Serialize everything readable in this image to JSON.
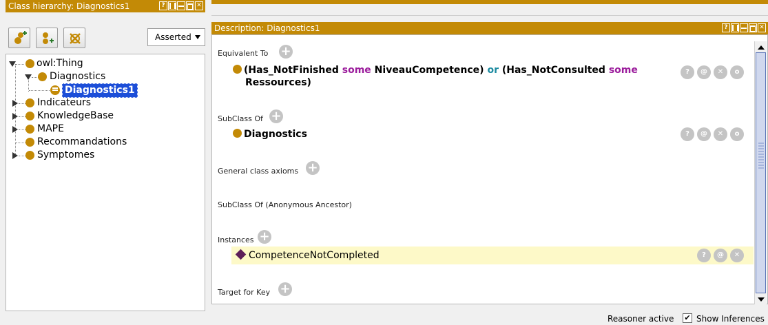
{
  "class_hierarchy": {
    "title": "Class hierarchy: Diagnostics1",
    "header_buttons": [
      "?"
    ],
    "toolbar": {
      "add_subclass_icon": "add-subclass-icon",
      "add_sibling_icon": "add-sibling-icon",
      "delete_class_icon": "delete-class-icon",
      "mode_select": "Asserted"
    },
    "tree": {
      "root": "owl:Thing",
      "items": [
        {
          "label": "Diagnostics",
          "expanded": true
        },
        {
          "label": "Diagnostics1",
          "selected": true
        },
        {
          "label": "Indicateurs",
          "expanded": false
        },
        {
          "label": "KnowledgeBase",
          "expanded": false
        },
        {
          "label": "MAPE",
          "expanded": false
        },
        {
          "label": "Recommandations",
          "leaf": true
        },
        {
          "label": "Symptomes",
          "expanded": false
        }
      ]
    }
  },
  "description": {
    "title": "Description: Diagnostics1",
    "header_buttons": [
      "?"
    ],
    "sections": {
      "equivalent_to": {
        "title": "Equivalent To",
        "axiom": {
          "p1": "(Has_NotFinished",
          "some1": "some",
          "p2": "NiveauCompetence)",
          "or": "or",
          "p3": "(Has_NotConsulted",
          "some2": "some",
          "p4": "Ressources)"
        }
      },
      "subclass_of": {
        "title": "SubClass Of",
        "axiom": "Diagnostics"
      },
      "general_class_axioms": {
        "title": "General class axioms"
      },
      "anonymous_ancestor": {
        "title": "SubClass Of (Anonymous Ancestor)"
      },
      "instances": {
        "title": "Instances",
        "item": "CompetenceNotCompleted"
      },
      "target_for_key": {
        "title": "Target for Key"
      }
    },
    "action_labels": {
      "explain": "?",
      "annotate": "@",
      "delete": "✕",
      "edit": "o"
    }
  },
  "status_bar": {
    "reasoner": "Reasoner active",
    "show_inferences": "Show Inferences",
    "show_inferences_checked": true
  }
}
